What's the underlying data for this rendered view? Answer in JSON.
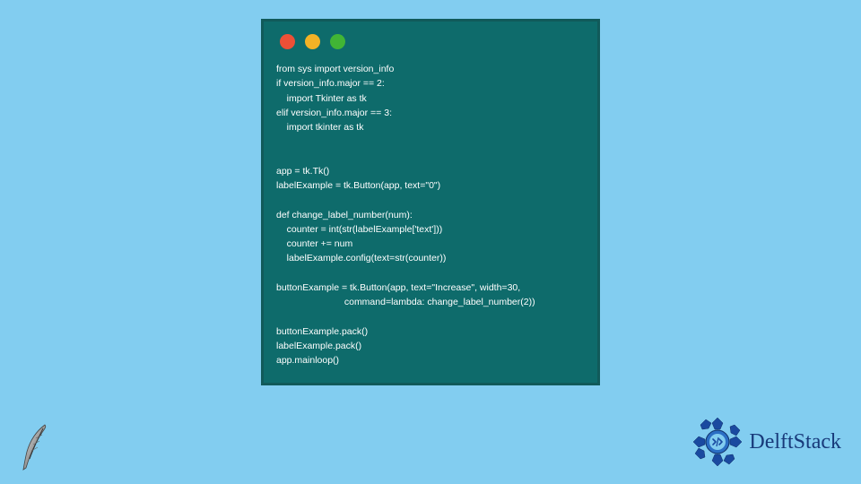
{
  "code_window": {
    "lines": "from sys import version_info\nif version_info.major == 2:\n    import Tkinter as tk\nelif version_info.major == 3:\n    import tkinter as tk\n\n\napp = tk.Tk()\nlabelExample = tk.Button(app, text=\"0\")\n\ndef change_label_number(num):\n    counter = int(str(labelExample['text']))\n    counter += num\n    labelExample.config(text=str(counter))\n\nbuttonExample = tk.Button(app, text=\"Increase\", width=30,\n                          command=lambda: change_label_number(2))\n\nbuttonExample.pack()\nlabelExample.pack()\napp.mainloop()"
  },
  "brand": {
    "name": "DelftStack"
  }
}
